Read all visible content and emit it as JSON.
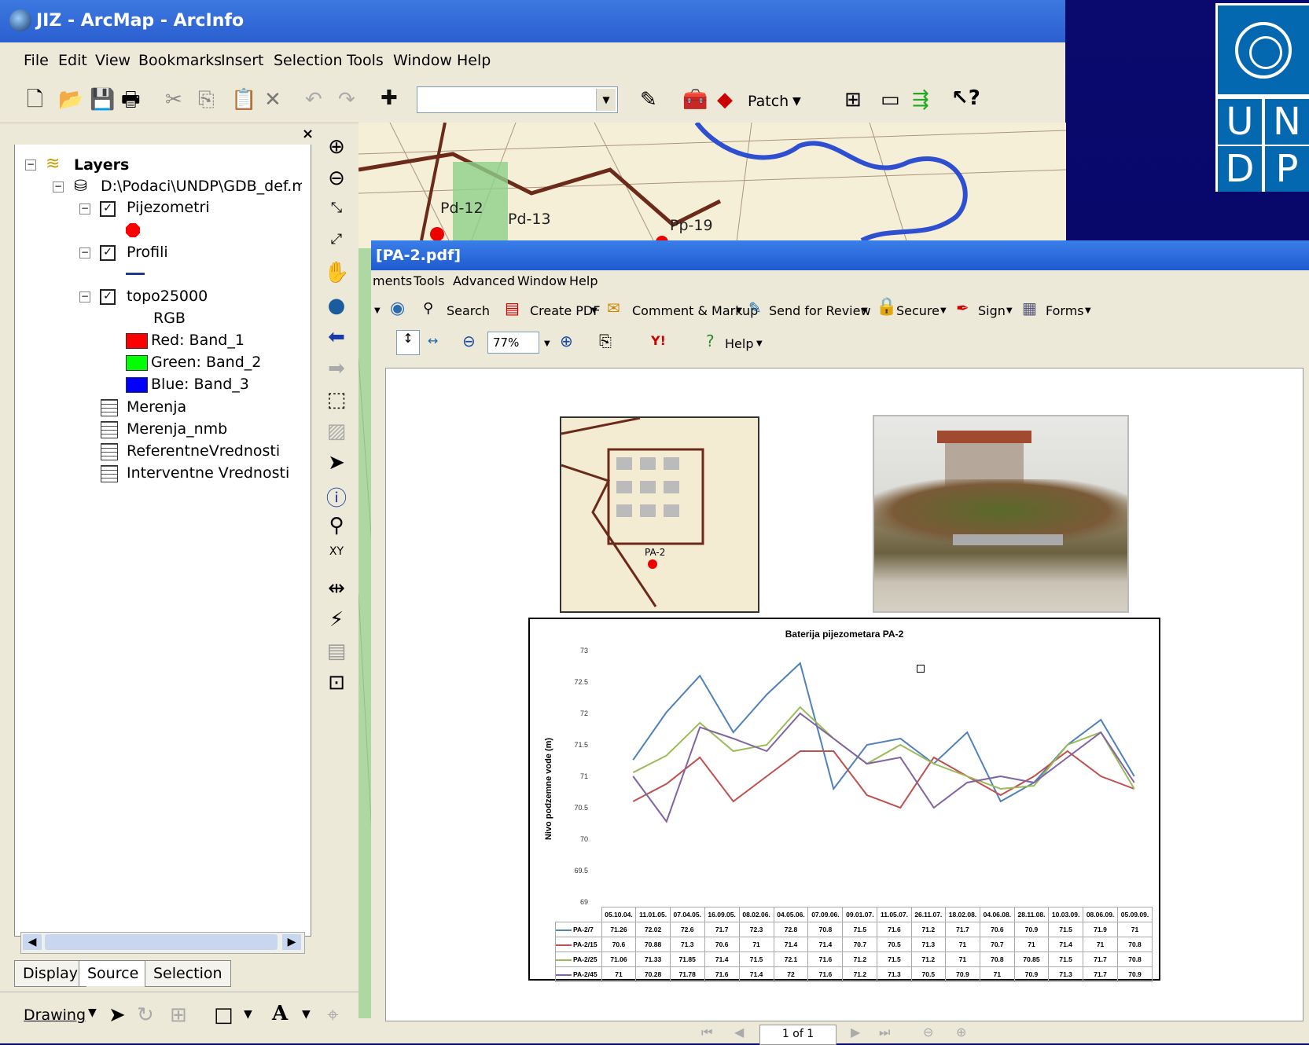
{
  "arcmap": {
    "title": "JIZ - ArcMap - ArcInfo",
    "menu": [
      "File",
      "Edit",
      "View",
      "Bookmarks",
      "Insert",
      "Selection",
      "Tools",
      "Window",
      "Help"
    ],
    "toolbar": {
      "patch_label": "Patch"
    },
    "toc": {
      "root": "Layers",
      "database": "D:\\Podaci\\UNDP\\GDB_def.mdb",
      "layers": [
        "Pijezometri",
        "Profili",
        "topo25000"
      ],
      "rgb_label": "RGB",
      "bands": [
        {
          "label": "Red:   Band_1",
          "color": "#ff0000"
        },
        {
          "label": "Green: Band_2",
          "color": "#00ff00"
        },
        {
          "label": "Blue:   Band_3",
          "color": "#0000ff"
        }
      ],
      "tables": [
        "Merenja",
        "Merenja_nmb",
        "ReferentneVrednosti",
        "Interventne Vrednosti"
      ]
    },
    "tabs": [
      "Display",
      "Source",
      "Selection"
    ],
    "drawing_label": "Drawing",
    "map_labels": [
      "Pd-12",
      "Pd-13",
      "Pp-19"
    ]
  },
  "pdf": {
    "title": "[PA-2.pdf]",
    "menu": [
      "ments",
      "Tools",
      "Advanced",
      "Window",
      "Help"
    ],
    "toolbar1": {
      "search": "Search",
      "create_pdf": "Create PDF",
      "comment": "Comment & Markup",
      "send": "Send for Review",
      "secure": "Secure",
      "sign": "Sign",
      "forms": "Forms"
    },
    "toolbar2": {
      "zoom": "77%",
      "help": "Help"
    },
    "page_indicator": "1 of 1",
    "map_thumb_label": "PA-2"
  },
  "chart_data": {
    "type": "line",
    "title": "Baterija pijezometara PA-2",
    "xlabel": "",
    "ylabel": "Nivo podzemne vode (m)",
    "ylim": [
      69,
      73
    ],
    "yticks": [
      "73",
      "72.5",
      "72",
      "71.5",
      "71",
      "70.5",
      "70",
      "69.5",
      "69"
    ],
    "categories": [
      "05.10.04.",
      "11.01.05.",
      "07.04.05.",
      "16.09.05.",
      "08.02.06.",
      "04.05.06.",
      "07.09.06.",
      "09.01.07.",
      "11.05.07.",
      "26.11.07.",
      "18.02.08.",
      "04.06.08.",
      "28.11.08.",
      "10.03.09.",
      "08.06.09.",
      "05.09.09."
    ],
    "series": [
      {
        "name": "PA-2/7",
        "color": "#4f81bd",
        "values": [
          71.26,
          72.02,
          72.6,
          71.7,
          72.3,
          72.8,
          70.8,
          71.5,
          71.6,
          71.2,
          71.7,
          70.6,
          70.9,
          71.5,
          71.9,
          71
        ]
      },
      {
        "name": "PA-2/15",
        "color": "#c0504d",
        "values": [
          70.6,
          70.88,
          71.3,
          70.6,
          71,
          71.4,
          71.4,
          70.7,
          70.5,
          71.3,
          71,
          70.7,
          71,
          71.4,
          71,
          70.8
        ]
      },
      {
        "name": "PA-2/25",
        "color": "#9bbb59",
        "values": [
          71.06,
          71.33,
          71.85,
          71.4,
          71.5,
          72.1,
          71.6,
          71.2,
          71.5,
          71.2,
          71,
          70.8,
          70.85,
          71.5,
          71.7,
          70.8
        ]
      },
      {
        "name": "PA-2/45",
        "color": "#8064a2",
        "values": [
          71,
          70.28,
          71.78,
          71.6,
          71.4,
          72,
          71.6,
          71.2,
          71.3,
          70.5,
          70.9,
          71,
          70.9,
          71.3,
          71.7,
          70.9
        ]
      }
    ],
    "table_values": [
      [
        "71.26",
        "72.02",
        "72.6",
        "71.7",
        "72.3",
        "72.8",
        "70.8",
        "71.5",
        "71.6",
        "71.2",
        "71.7",
        "70.6",
        "70.9",
        "71.5",
        "71.9",
        "71"
      ],
      [
        "70.6",
        "70.88",
        "71.3",
        "70.6",
        "71",
        "71.4",
        "71.4",
        "70.7",
        "70.5",
        "71.3",
        "71",
        "70.7",
        "71",
        "71.4",
        "71",
        "70.8"
      ],
      [
        "71.06",
        "71.33",
        "71.85",
        "71.4",
        "71.5",
        "72.1",
        "71.6",
        "71.2",
        "71.5",
        "71.2",
        "71",
        "70.8",
        "70.85",
        "71.5",
        "71.7",
        "70.8"
      ],
      [
        "71",
        "70.28",
        "71.78",
        "71.6",
        "71.4",
        "72",
        "71.6",
        "71.2",
        "71.3",
        "70.5",
        "70.9",
        "71",
        "70.9",
        "71.3",
        "71.7",
        "70.9"
      ]
    ],
    "grid": false,
    "legend": "table"
  },
  "logo": {
    "letters": [
      "U",
      "N",
      "D",
      "P"
    ]
  }
}
